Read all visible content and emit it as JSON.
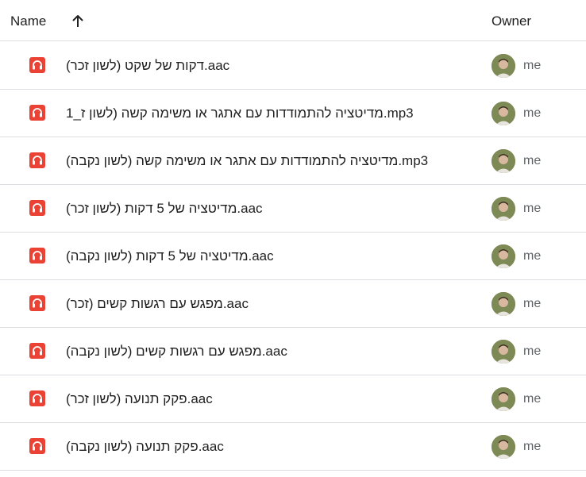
{
  "header": {
    "name_label": "Name",
    "sort_icon": "arrow-up-icon",
    "owner_label": "Owner"
  },
  "colors": {
    "audio_icon_bg": "#ea4335",
    "divider": "#dadce0",
    "owner_text": "#5f6368"
  },
  "files": [
    {
      "name": "דקות של שקט (לשון זכר).aac",
      "icon": "headphones-icon",
      "owner": "me"
    },
    {
      "name": "מדיטציה להתמודדות עם אתגר או  משימה קשה (לשון ז_1.mp3",
      "icon": "headphones-icon",
      "owner": "me"
    },
    {
      "name": "מדיטציה להתמודדות עם אתגר או משימה קשה (לשון נקבה).mp3",
      "icon": "headphones-icon",
      "owner": "me"
    },
    {
      "name": "מדיטציה של 5 דקות (לשון זכר).aac",
      "icon": "headphones-icon",
      "owner": "me"
    },
    {
      "name": "מדיטציה של 5 דקות (לשון נקבה).aac",
      "icon": "headphones-icon",
      "owner": "me"
    },
    {
      "name": "מפגש עם רגשות קשים (זכר).aac",
      "icon": "headphones-icon",
      "owner": "me"
    },
    {
      "name": "מפגש עם רגשות קשים (לשון נקבה).aac",
      "icon": "headphones-icon",
      "owner": "me"
    },
    {
      "name": "פקק תנועה (לשון זכר).aac",
      "icon": "headphones-icon",
      "owner": "me"
    },
    {
      "name": "פקק תנועה (לשון נקבה).aac",
      "icon": "headphones-icon",
      "owner": "me"
    }
  ]
}
